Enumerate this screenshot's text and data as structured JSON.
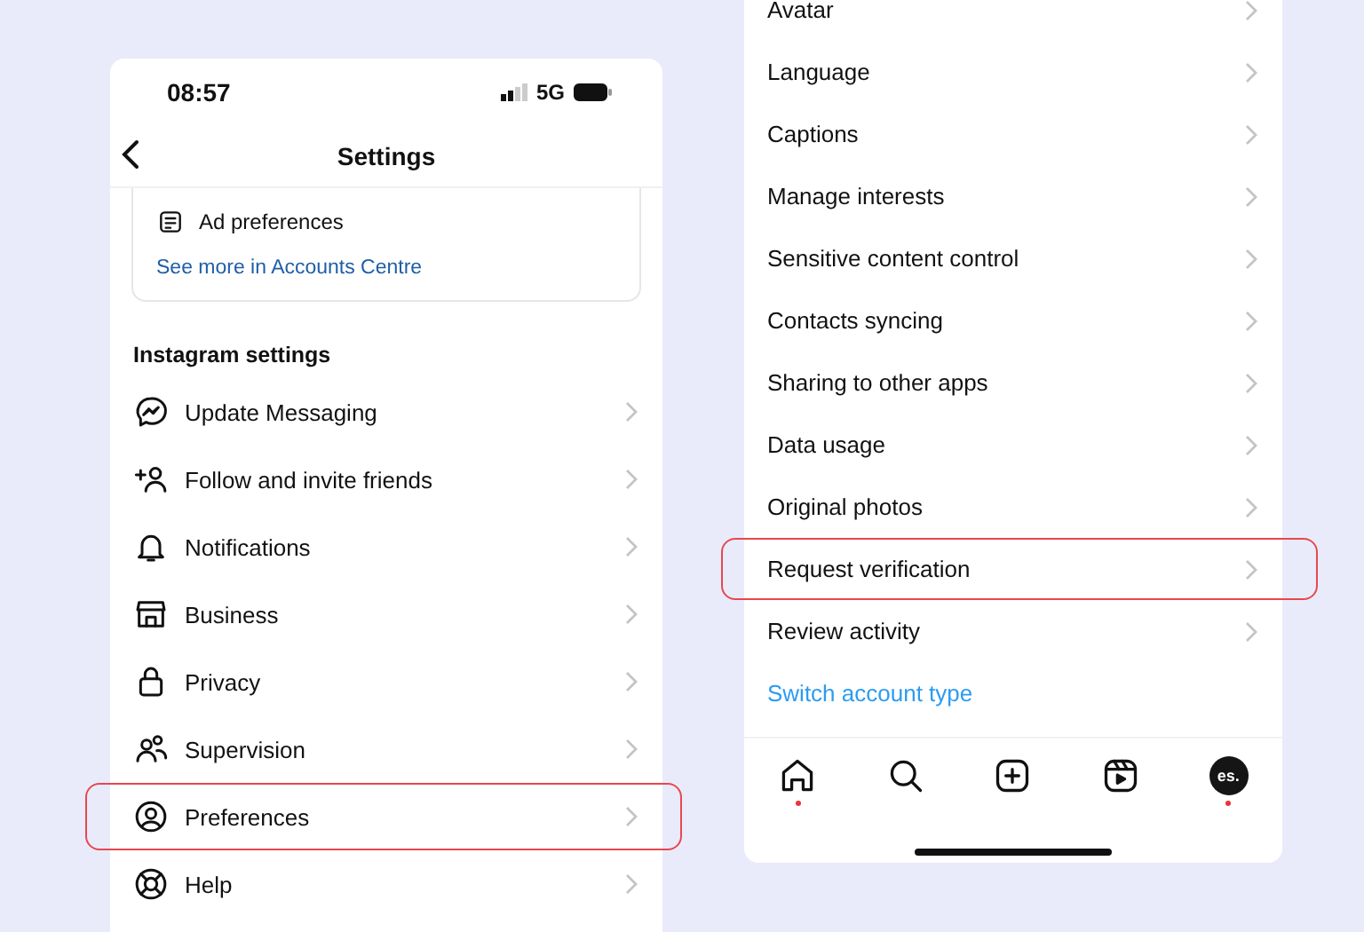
{
  "left_phone": {
    "status_bar": {
      "time": "08:57",
      "network": "5G"
    },
    "header": {
      "title": "Settings"
    },
    "accounts_card": {
      "items": [
        {
          "label": "Ad preferences"
        }
      ],
      "link": "See more in Accounts Centre"
    },
    "section_title": "Instagram settings",
    "items": [
      {
        "label": "Update Messaging",
        "highlighted": false
      },
      {
        "label": "Follow and invite friends",
        "highlighted": false
      },
      {
        "label": "Notifications",
        "highlighted": false
      },
      {
        "label": "Business",
        "highlighted": false
      },
      {
        "label": "Privacy",
        "highlighted": false
      },
      {
        "label": "Supervision",
        "highlighted": false
      },
      {
        "label": "Preferences",
        "highlighted": true
      },
      {
        "label": "Help",
        "highlighted": false
      }
    ]
  },
  "right_phone": {
    "items": [
      {
        "label": "Avatar",
        "highlighted": false
      },
      {
        "label": "Language",
        "highlighted": false
      },
      {
        "label": "Captions",
        "highlighted": false
      },
      {
        "label": "Manage interests",
        "highlighted": false
      },
      {
        "label": "Sensitive content control",
        "highlighted": false
      },
      {
        "label": "Contacts syncing",
        "highlighted": false
      },
      {
        "label": "Sharing to other apps",
        "highlighted": false
      },
      {
        "label": "Data usage",
        "highlighted": false
      },
      {
        "label": "Original photos",
        "highlighted": false
      },
      {
        "label": "Request verification",
        "highlighted": true
      },
      {
        "label": "Review activity",
        "highlighted": false
      }
    ],
    "link": "Switch account type",
    "tab_bar": [
      {
        "dot": true
      },
      {
        "dot": false
      },
      {
        "dot": false
      },
      {
        "dot": false
      },
      {
        "dot": true,
        "avatar_text": "es."
      }
    ]
  }
}
